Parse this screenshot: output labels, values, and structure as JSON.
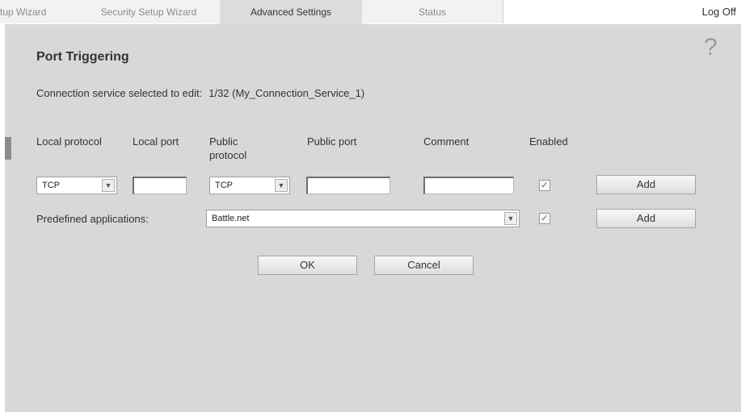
{
  "tabs": [
    {
      "label": "tup Wizard"
    },
    {
      "label": "Security Setup Wizard"
    },
    {
      "label": "Advanced Settings"
    },
    {
      "label": "Status"
    }
  ],
  "header": {
    "logoff_label": "Log Off",
    "help_symbol": "?"
  },
  "page": {
    "title": "Port Triggering",
    "connection_label": "Connection service selected to edit:",
    "connection_value": "1/32 (My_Connection_Service_1)"
  },
  "table": {
    "headers": {
      "local_protocol": "Local protocol",
      "local_port": "Local port",
      "public_protocol_line1": "Public",
      "public_protocol_line2": "protocol",
      "public_port": "Public port",
      "comment": "Comment",
      "enabled": "Enabled"
    },
    "row": {
      "local_protocol": "TCP",
      "local_port": "",
      "public_protocol": "TCP",
      "public_port": "",
      "comment": "",
      "enabled": true,
      "add_label": "Add"
    }
  },
  "predefined": {
    "label": "Predefined applications:",
    "value": "Battle.net",
    "enabled": true,
    "add_label": "Add"
  },
  "actions": {
    "ok_label": "OK",
    "cancel_label": "Cancel"
  },
  "icons": {
    "dropdown": "chevron-down-icon",
    "check": "checkmark-icon",
    "help": "help-icon"
  }
}
